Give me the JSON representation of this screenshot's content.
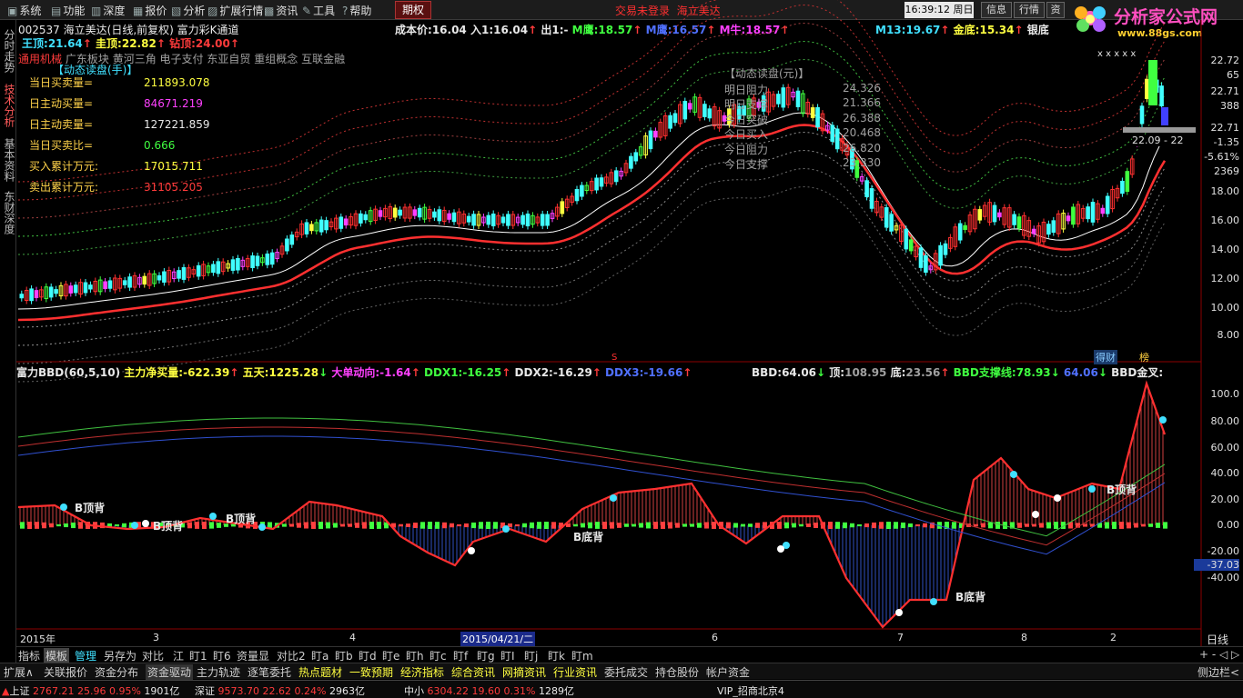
{
  "menu": {
    "items": [
      "系统",
      "功能",
      "深度",
      "报价",
      "分析",
      "扩展行情",
      "资讯",
      "工具",
      "帮助"
    ],
    "qi_tab": "期权",
    "login_status": "交易未登录",
    "login_stock": "海立美达",
    "clock": "16:39:12 周日",
    "buttons": [
      "信息",
      "行情",
      "资"
    ]
  },
  "logo": {
    "title": "分析家公式网",
    "url": "www.88gs.com"
  },
  "left_tabs": [
    "分时走势",
    "技术分析",
    "基本资料",
    "东财深度"
  ],
  "header": {
    "code": "002537",
    "name": "海立美达(日线,前复权)",
    "indicator_name": "富力彩K通道",
    "cost_label": "成本价:",
    "cost_value": "16.04",
    "in_label": "入1:",
    "in_value": "16.04",
    "out_label": "出1:",
    "out_value": "-",
    "m1_label": "M鹰:",
    "m1_value": "18.57",
    "m2_label": "M鹰:",
    "m2_value": "16.57",
    "m3_label": "M牛:",
    "m3_value": "18.57",
    "m13_label": "M13:",
    "m13_value": "19.67",
    "jindi_label": "金底:",
    "jindi_value": "15.34",
    "yindi_label": "银底"
  },
  "row2": {
    "wangding_label": "王顶:",
    "wangding_value": "21.64",
    "zhending_label": "圭顶:",
    "zhending_value": "22.82",
    "zuanding_label": "钻顶:",
    "zuanding_value": "24.00"
  },
  "sectors": {
    "lead": "通用机械",
    "items": [
      "广东板块",
      "黄河三角",
      "电子支付",
      "东亚自贸",
      "重组概念",
      "互联金融"
    ]
  },
  "order_panel": {
    "title": "【动态读盘(手)】",
    "rows": [
      {
        "label": "当日买卖量=",
        "value": "211893.078"
      },
      {
        "label": "日主动买量=",
        "value": "84671.219"
      },
      {
        "label": "日主动卖量=",
        "value": "127221.859"
      },
      {
        "label": "当日买卖比=",
        "value": "0.666"
      },
      {
        "label": "买入累计万元:",
        "value": "17015.711"
      },
      {
        "label": "卖出累计万元:",
        "value": "31105.205"
      }
    ]
  },
  "dyn_panel": {
    "title": "【动态读盘(元)】",
    "rows": [
      {
        "label": "明日阻力",
        "value": "24.326"
      },
      {
        "label": "明日支撑",
        "value": "21.366"
      },
      {
        "label": "今日突破",
        "value": "26.388"
      },
      {
        "label": "今日买入",
        "value": "20.468"
      },
      {
        "label": "今日阻力",
        "value": "26.820"
      },
      {
        "label": "今日支撑",
        "value": "23.330"
      }
    ]
  },
  "price_axis": {
    "ticks": [
      "22.72",
      "65",
      "22.71",
      "388",
      "22.71",
      "-1.35",
      "-5.61%",
      "2369",
      "18.00",
      "16.00",
      "14.00",
      "12.00",
      "10.00",
      "8.00"
    ],
    "current_price": "22.09",
    "current_tail": "22",
    "markers": "x x x x x"
  },
  "indicator": {
    "name": "富力BBD(60,5,10)",
    "main_net_label": "主力净买量:",
    "main_net_value": "-622.39",
    "five_day_label": "五天:",
    "five_day_value": "1225.28",
    "big_order_label": "大单动向:",
    "big_order_value": "-1.64",
    "ddx1_label": "DDX1:",
    "ddx1_value": "-16.25",
    "ddx2_label": "DDX2:",
    "ddx2_value": "-16.29",
    "ddx3_label": "DDX3:",
    "ddx3_value": "-19.66",
    "bbd_label": "BBD:",
    "bbd_value": "64.06",
    "top_label": "顶:",
    "top_value": "108.95",
    "bottom_label": "底:",
    "bottom_value": "23.56",
    "support_label": "BBD支撑线:",
    "support_value": "78.93",
    "extra_value": "64.06",
    "cross_label": "BBD金叉:",
    "tag_finance": "得财",
    "tag_board": "榜",
    "s_marker": "S",
    "axis_ticks": [
      "100.0",
      "80.00",
      "60.00",
      "40.00",
      "20.00",
      "0.00",
      "-20.00",
      "-37.03",
      "-40.00"
    ],
    "labels": [
      "B顶背",
      "B顶背",
      "B顶背",
      "B底背",
      "B底背",
      "B顶背"
    ]
  },
  "date_axis": {
    "labels": [
      "2015年",
      "3",
      "4",
      "2015/04/21/二",
      "6",
      "7",
      "8",
      "2"
    ],
    "period": "日线"
  },
  "bottom_tabs": [
    "指标",
    "模板",
    "管理",
    "另存为",
    "对比",
    "江",
    "盯1",
    "盯6",
    "资量显",
    "对比2",
    "盯a",
    "盯b",
    "盯d",
    "盯e",
    "盯h",
    "盯c",
    "盯f",
    "盯g",
    "盯I",
    "盯j",
    "盯k",
    "盯m"
  ],
  "bottom_right": "+ - ◁ ▷",
  "func_bar": [
    "扩展∧",
    "关联报价",
    "资金分布",
    "资金驱动",
    "主力轨迹",
    "逐笔委托",
    "热点题材",
    "一致预期",
    "经济指标",
    "综合资讯",
    "网摘资讯",
    "行业资讯",
    "委托成交",
    "持仓股份",
    "帐户资金"
  ],
  "func_bar_right": "侧边栏<",
  "status_bar": {
    "sh_label": "上证",
    "sh_value": "2767.21",
    "sh_change": "25.96",
    "sh_pct": "0.95%",
    "sh_amount": "1901亿",
    "sz_label": "深证",
    "sz_value": "9573.70",
    "sz_change": "22.62",
    "sz_pct": "0.24%",
    "sz_amount": "2963亿",
    "zx_label": "中小",
    "zx_value": "6304.22",
    "zx_change": "19.60",
    "zx_pct": "0.31%",
    "zx_amount": "1289亿",
    "server": "VIP_招商北京4"
  },
  "colors": {
    "up": "#ff3b3b",
    "down": "#40ffff",
    "bg": "#000000",
    "accent": "#ffff40"
  }
}
